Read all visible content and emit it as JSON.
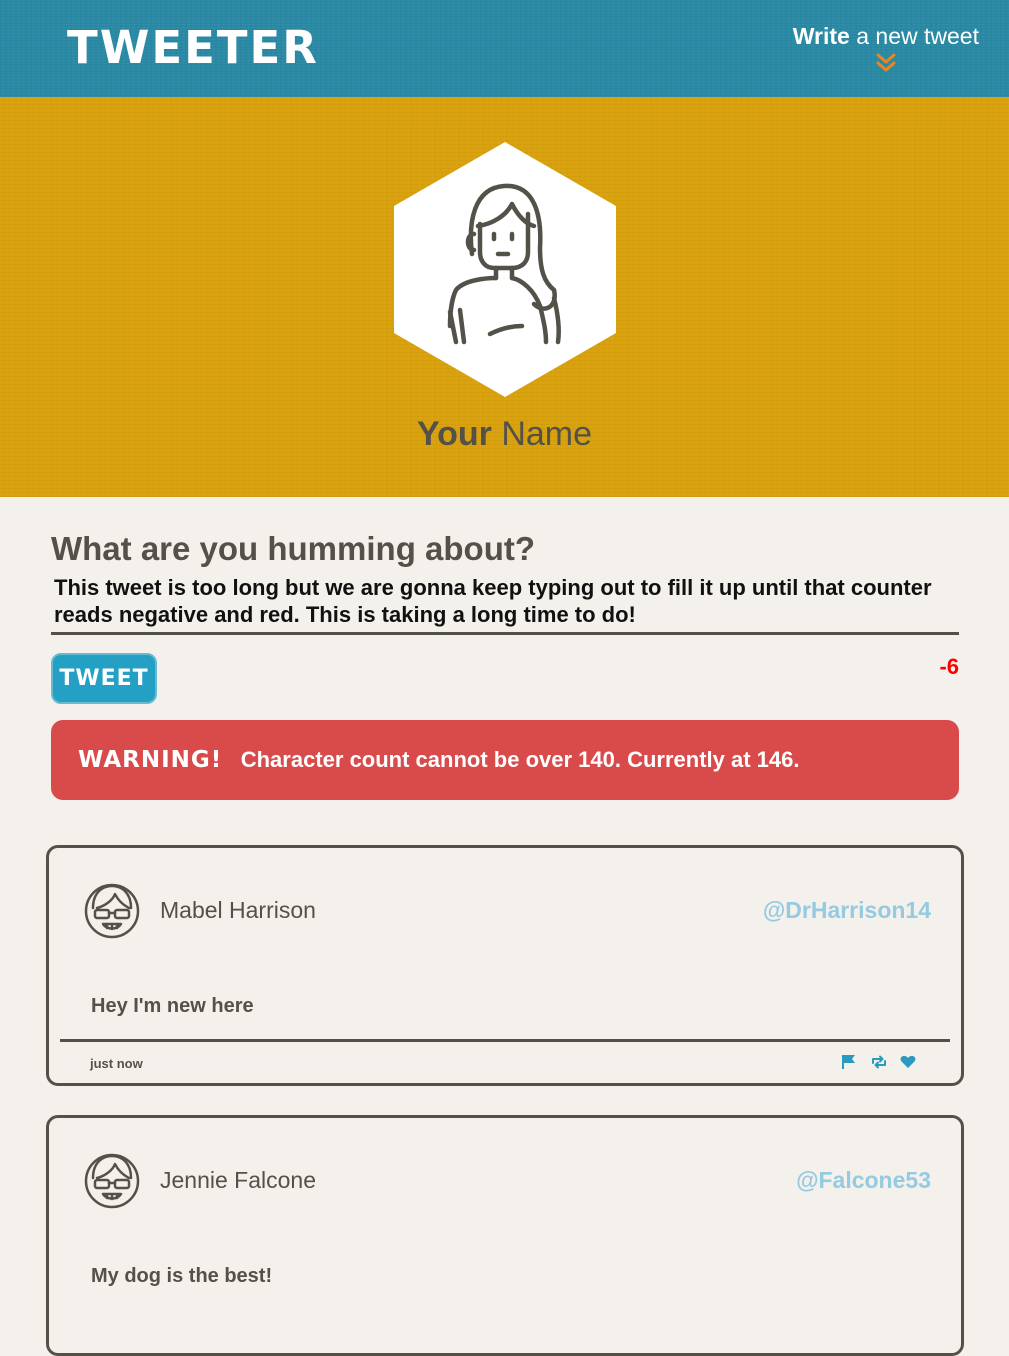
{
  "nav": {
    "logo": "TWEETER",
    "compose_strong": "Write",
    "compose_light": "a new tweet",
    "chevron_icon": "double-chevron-down-icon",
    "accent_color": "#e8871e"
  },
  "profile": {
    "avatar_icon": "woman-avatar-icon",
    "name_first": "Your",
    "name_last": "Name"
  },
  "composer": {
    "heading": "What are you humming about?",
    "text": "This tweet is too long but we are gonna keep typing out to fill it up until that counter reads negative and red. This is taking a long time to do!",
    "submit_label": "TWEET",
    "counter": "-6",
    "counter_color": "#ff0000"
  },
  "warning": {
    "label": "WARNING!",
    "message": "Character count cannot be over 140. Currently at 146."
  },
  "tweets": [
    {
      "name": "Mabel Harrison",
      "handle": "@DrHarrison14",
      "body": "Hey I'm new here",
      "time": "just now",
      "avatar_icon": "sunglasses-avatar-icon"
    },
    {
      "name": "Jennie Falcone",
      "handle": "@Falcone53",
      "body": "My dog is the best!",
      "avatar_icon": "sunglasses-avatar-icon"
    }
  ],
  "actions": {
    "flag_icon": "flag-icon",
    "retweet_icon": "retweet-icon",
    "like_icon": "heart-icon",
    "action_color": "#2a9bbf"
  },
  "colors": {
    "nav_bg": "#2a8aa5",
    "header_bg": "#d9a10c",
    "page_bg": "#f4f1ec",
    "warning_bg": "#d94b4b",
    "button_bg": "#24a0c4",
    "handle": "#94cbe0"
  }
}
